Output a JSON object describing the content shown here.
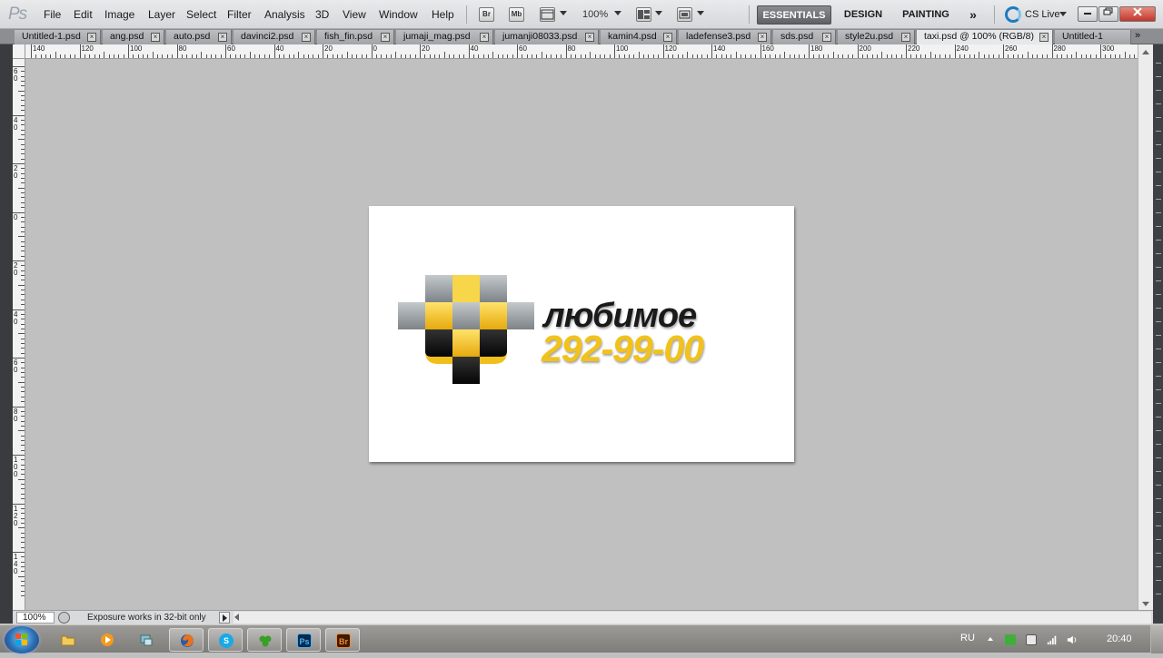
{
  "app": {
    "logo_text": "Ps",
    "menu": [
      "File",
      "Edit",
      "Image",
      "Layer",
      "Select",
      "Filter",
      "Analysis",
      "3D",
      "View",
      "Window",
      "Help"
    ],
    "toolbar": {
      "bridge_label": "Br",
      "minibridge_label": "Mb",
      "zoom_value": "100%"
    },
    "workspaces": {
      "essentials": "ESSENTIALS",
      "design": "DESIGN",
      "painting": "PAINTING",
      "more": "»"
    },
    "cs_live": "CS Live"
  },
  "tabs": [
    {
      "label": "Untitled-1.psd"
    },
    {
      "label": "ang.psd"
    },
    {
      "label": "auto.psd"
    },
    {
      "label": "davinci2.psd"
    },
    {
      "label": "fish_fin.psd"
    },
    {
      "label": "jumaji_mag.psd"
    },
    {
      "label": "jumanji08033.psd"
    },
    {
      "label": "kamin4.psd"
    },
    {
      "label": "ladefense3.psd"
    },
    {
      "label": "sds.psd"
    },
    {
      "label": "style2u.psd"
    },
    {
      "label": "taxi.psd @ 100% (RGB/8)",
      "active": true
    },
    {
      "label": "Untitled-1"
    }
  ],
  "tab_overflow": "»",
  "ruler_top_labels": [
    "140",
    "120",
    "100",
    "80",
    "60",
    "40",
    "20",
    "0",
    "20",
    "40",
    "60",
    "80",
    "100",
    "120",
    "140",
    "160",
    "180",
    "200",
    "220",
    "240",
    "260",
    "280",
    "300"
  ],
  "ruler_left_labels": [
    "60",
    "40",
    "20",
    "0",
    "20",
    "40",
    "60",
    "80",
    "100",
    "120",
    "140"
  ],
  "document": {
    "brand_word": "любимое",
    "phone": "292-99-00"
  },
  "status": {
    "zoom": "100%",
    "message": "Exposure works in 32-bit only"
  },
  "taskbar": {
    "apps": [
      {
        "name": "explorer",
        "active": false
      },
      {
        "name": "media-player",
        "active": false
      },
      {
        "name": "network",
        "active": false
      },
      {
        "name": "firefox",
        "active": true
      },
      {
        "name": "skype",
        "active": true
      },
      {
        "name": "green-app",
        "active": true
      },
      {
        "name": "photoshop",
        "active": true,
        "label": "Ps"
      },
      {
        "name": "bridge",
        "active": true,
        "label": "Br"
      }
    ],
    "language": "RU",
    "clock": "20:40"
  },
  "colors": {
    "taxi_yellow": "#f2c21a",
    "taxi_black": "#111111",
    "taxi_grey": "#9ea3a6",
    "essentials_bg": "#6e7074"
  }
}
